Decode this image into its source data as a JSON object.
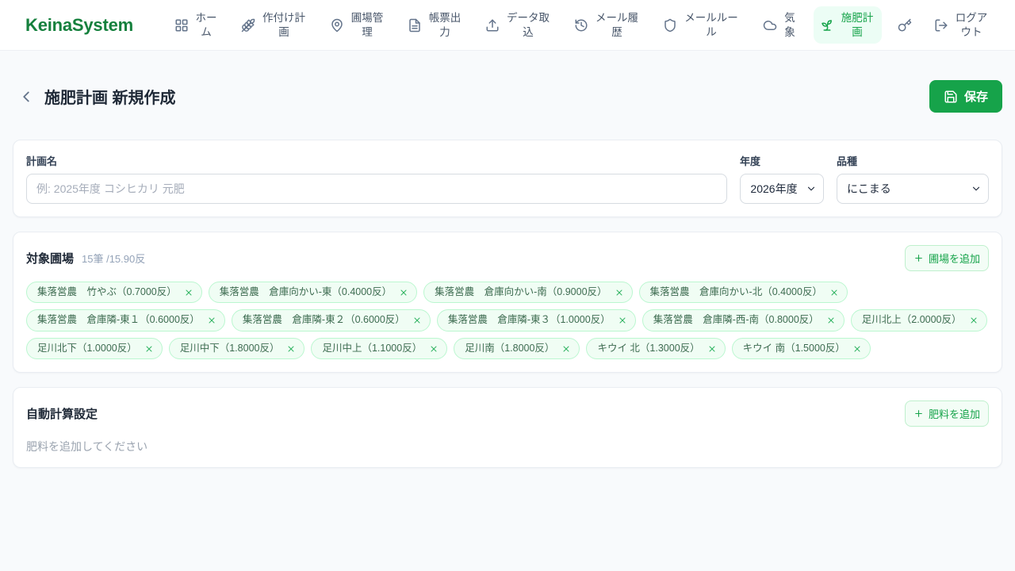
{
  "brand": "KeinaSystem",
  "nav": {
    "items": [
      {
        "name": "nav-item-home",
        "label": "ホーム",
        "icon": "grid-icon",
        "active": false
      },
      {
        "name": "nav-item-planting-plan",
        "label": "作付け計画",
        "icon": "wheat-icon",
        "active": false
      },
      {
        "name": "nav-item-field-management",
        "label": "圃場管理",
        "icon": "map-pin-icon",
        "active": false
      },
      {
        "name": "nav-item-report-output",
        "label": "帳票出力",
        "icon": "file-text-icon",
        "active": false
      },
      {
        "name": "nav-item-data-import",
        "label": "データ取込",
        "icon": "upload-icon",
        "active": false
      },
      {
        "name": "nav-item-mail-history",
        "label": "メール履歴",
        "icon": "history-icon",
        "active": false
      },
      {
        "name": "nav-item-mail-rules",
        "label": "メールルール",
        "icon": "shield-icon",
        "active": false
      },
      {
        "name": "nav-item-weather",
        "label": "気象",
        "icon": "cloud-icon",
        "active": false
      },
      {
        "name": "nav-item-fertilization-plan",
        "label": "施肥計画",
        "icon": "sprout-icon",
        "active": true
      },
      {
        "name": "nav-item-key",
        "label": "",
        "icon": "key-icon",
        "active": false
      },
      {
        "name": "nav-item-logout",
        "label": "ログアウト",
        "icon": "logout-icon",
        "active": false
      }
    ]
  },
  "header": {
    "title": "施肥計画 新規作成",
    "save_label": "保存"
  },
  "plan_form": {
    "name_label": "計画名",
    "name_placeholder": "例: 2025年度 コシヒカリ 元肥",
    "name_value": "",
    "year_label": "年度",
    "year_value": "2026年度",
    "variety_label": "品種",
    "variety_value": "にこまる"
  },
  "fields_section": {
    "title": "対象圃場",
    "count_text": "15筆 /15.90反",
    "add_button_label": "圃場を追加",
    "chips": [
      "集落営農　竹やぶ（0.7000反）",
      "集落営農　倉庫向かい-東（0.4000反）",
      "集落営農　倉庫向かい-南（0.9000反）",
      "集落営農　倉庫向かい-北（0.4000反）",
      "集落営農　倉庫隣-東１（0.6000反）",
      "集落営農　倉庫隣-東２（0.6000反）",
      "集落営農　倉庫隣-東３（1.0000反）",
      "集落営農　倉庫隣-西-南（0.8000反）",
      "足川北上（2.0000反）",
      "足川北下（1.0000反）",
      "足川中下（1.8000反）",
      "足川中上（1.1000反）",
      "足川南（1.8000反）",
      "キウイ 北（1.3000反）",
      "キウイ 南（1.5000反）"
    ]
  },
  "fertilizer_section": {
    "title": "自動計算設定",
    "add_button_label": "肥料を追加",
    "empty_text": "肥料を追加してください"
  },
  "colors": {
    "primary_green": "#16a34a",
    "brand_green": "#15803d",
    "active_nav_bg": "#ecfdf5",
    "chip_bg": "#f0fdf4",
    "chip_border": "#bbf7d0",
    "page_bg": "#f8fafc"
  }
}
